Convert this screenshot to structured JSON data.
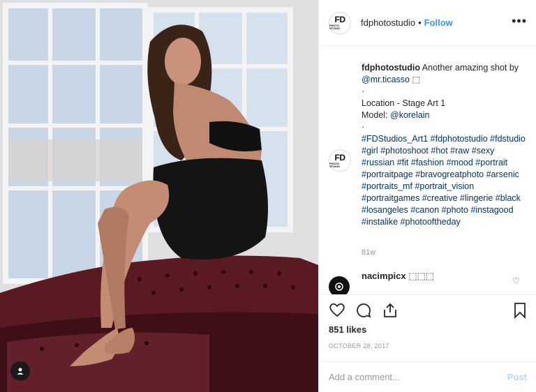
{
  "header": {
    "logo_text": "FD",
    "logo_sub": "PHOTO STUDIO",
    "username": "fdphotostudio",
    "separator": "•",
    "follow_label": "Follow",
    "more_icon": "ellipsis-icon"
  },
  "caption": {
    "username": "fdphotostudio",
    "line1": " Another amazing shot by ",
    "mention1": "@mr.ticasso",
    "emoji1": " ⬚",
    "dot1": "·",
    "location": "Location - Stage Art 1",
    "model_label": "Model: ",
    "mention2": "@korelain",
    "dot2": "·",
    "hashtags": "#FDStudios_Art1 #fdphotostudio #fdstudio #girl #photoshoot #hot #raw #sexy #russian #fit #fashion #mood #portrait #portraitpage #bravogreatphoto #arsenic #portraits_mf #portrait_vision #portraitgames #creative #lingerie #black #losangeles #canon #photo #instagood #instalike #photooftheday",
    "age": "81w"
  },
  "comment2": {
    "username": "nacimpicx",
    "text": " ⬚⬚⬚"
  },
  "actions": {
    "likes": "851 likes",
    "date": "OCTOBER 28, 2017"
  },
  "add_comment": {
    "placeholder": "Add a comment...",
    "post_label": "Post"
  }
}
